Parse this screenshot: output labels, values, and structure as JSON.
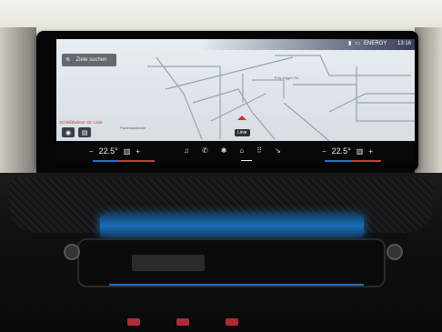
{
  "status_bar": {
    "energy_label": "ENERGY",
    "time": "13:16"
  },
  "map": {
    "search_placeholder": "Ziele suchen",
    "street_label": "Fritz-Egger-Str.",
    "poi_label": "Parkhausstraße",
    "lane_info": "Schleißheimer Str. Linie",
    "route_tooltip": "Linie"
  },
  "climate": {
    "left_temp": "22.5°",
    "right_temp": "22.5°",
    "minus": "−",
    "plus": "+"
  },
  "dock": {
    "items": [
      "media-icon",
      "phone-icon",
      "fan-icon",
      "home-icon",
      "apps-icon",
      "seat-icon"
    ]
  },
  "colors": {
    "accent_blue": "#1c6fb5",
    "accent_red": "#c0392b"
  }
}
